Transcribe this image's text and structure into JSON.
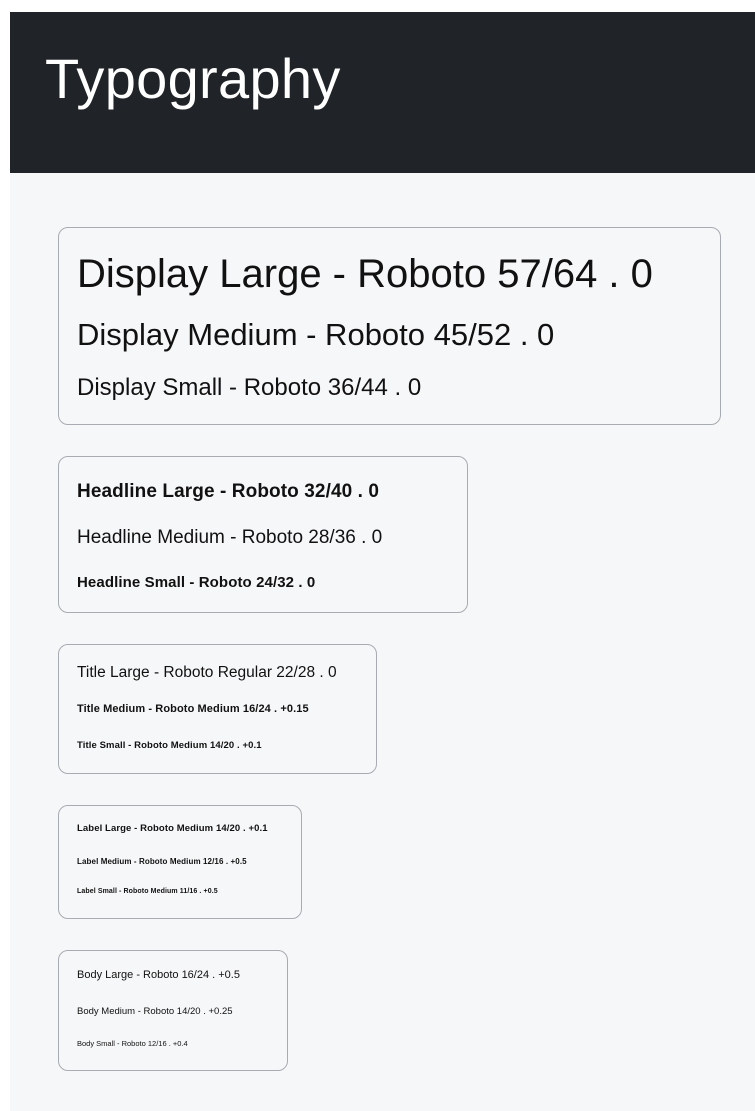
{
  "app_bar": {
    "title": "Typography",
    "background": "#202327"
  },
  "page_background": "#f6f7f9",
  "groups": {
    "display": [
      "Display Large - Roboto 57/64 . 0",
      "Display Medium - Roboto 45/52 .  0",
      "Display Small - Roboto 36/44 . 0"
    ],
    "headline": [
      "Headline Large - Roboto 32/40 . 0",
      "Headline Medium - Roboto 28/36 . 0",
      "Headline Small - Roboto 24/32 . 0"
    ],
    "title": [
      "Title Large - Roboto Regular 22/28 . 0",
      "Title Medium - Roboto Medium 16/24 . +0.15",
      "Title Small - Roboto Medium 14/20 . +0.1"
    ],
    "label": [
      "Label Large - Roboto Medium 14/20 . +0.1",
      "Label Medium - Roboto Medium 12/16 . +0.5",
      "Label Small - Roboto Medium 11/16 . +0.5"
    ],
    "body": [
      "Body Large - Roboto 16/24 . +0.5",
      "Body Medium - Roboto 14/20 . +0.25",
      "Body Small - Roboto 12/16 . +0.4"
    ]
  }
}
